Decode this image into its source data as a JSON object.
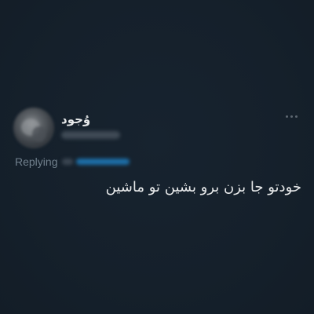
{
  "tweet": {
    "author": {
      "display_name": "وُجود",
      "avatar_icon": "avatar-image"
    },
    "replying_label": "Replying",
    "text": "خودتو جا بزن برو بشین تو ماشین",
    "more_icon": "more-horizontal-icon"
  },
  "colors": {
    "background": "#15202b",
    "text_primary": "#e7e9ea",
    "text_secondary": "#71808d",
    "link": "#1d9bf0"
  }
}
